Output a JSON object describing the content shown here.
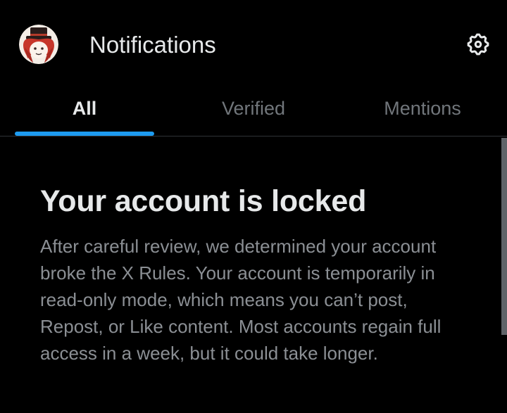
{
  "header": {
    "title": "Notifications",
    "avatar_icon": "profile-avatar-icon",
    "settings_icon": "gear-icon"
  },
  "tabs": [
    {
      "label": "All",
      "active": true
    },
    {
      "label": "Verified",
      "active": false
    },
    {
      "label": "Mentions",
      "active": false
    }
  ],
  "notice": {
    "title": "Your account is locked",
    "body": "After careful review, we determined your account broke the X Rules. Your account is temporarily in read-only mode, which means you can’t post, Repost, or Like content. Most accounts regain full access in a week, but it could take longer."
  },
  "colors": {
    "background": "#000000",
    "primary_text": "#e7e9ea",
    "secondary_text": "#8b8f94",
    "muted_tab": "#71767b",
    "accent": "#1d9bf0",
    "divider": "#2f3336"
  }
}
